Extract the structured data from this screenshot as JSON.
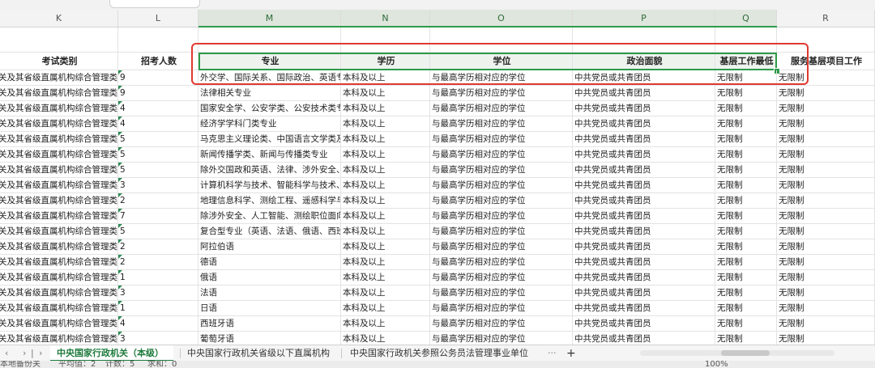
{
  "columns": [
    {
      "letter": "K"
    },
    {
      "letter": "L"
    },
    {
      "letter": "M"
    },
    {
      "letter": "N"
    },
    {
      "letter": "O"
    },
    {
      "letter": "P"
    },
    {
      "letter": "Q"
    },
    {
      "letter": "R"
    }
  ],
  "header_row": {
    "k": "考试类别",
    "l": "招考人数",
    "m": "专业",
    "n": "学历",
    "o": "学位",
    "p": "政治面貌",
    "q": "基层工作最低",
    "r": "服务基层项目工作"
  },
  "rows": [
    {
      "k": "关及其省级直属机构综合管理类",
      "l": "9",
      "m": "外交学、国际关系、国际政治、英语专业",
      "n": "本科及以上",
      "o": "与最高学历相对应的学位",
      "p": "中共党员或共青团员",
      "q": "无限制",
      "r": "无限制"
    },
    {
      "k": "关及其省级直属机构综合管理类",
      "l": "9",
      "m": "法律相关专业",
      "n": "本科及以上",
      "o": "与最高学历相对应的学位",
      "p": "中共党员或共青团员",
      "q": "无限制",
      "r": "无限制"
    },
    {
      "k": "关及其省级直属机构综合管理类",
      "l": "4",
      "m": "国家安全学、公安学类、公安技术类专业",
      "n": "本科及以上",
      "o": "与最高学历相对应的学位",
      "p": "中共党员或共青团员",
      "q": "无限制",
      "r": "无限制"
    },
    {
      "k": "关及其省级直属机构综合管理类",
      "l": "4",
      "m": "经济学学科门类专业",
      "n": "本科及以上",
      "o": "与最高学历相对应的学位",
      "p": "中共党员或共青团员",
      "q": "无限制",
      "r": "无限制"
    },
    {
      "k": "关及其省级直属机构综合管理类",
      "l": "5",
      "m": "马克思主义理论类、中国语言文学类及",
      "n": "本科及以上",
      "o": "与最高学历相对应的学位",
      "p": "中共党员或共青团员",
      "q": "无限制",
      "r": "无限制"
    },
    {
      "k": "关及其省级直属机构综合管理类",
      "l": "5",
      "m": "新闻传播学类、新闻与传播类专业",
      "n": "本科及以上",
      "o": "与最高学历相对应的学位",
      "p": "中共党员或共青团员",
      "q": "无限制",
      "r": "无限制"
    },
    {
      "k": "关及其省级直属机构综合管理类",
      "l": "5",
      "m": "除外交国政和英语、法律、涉外安全、",
      "n": "本科及以上",
      "o": "与最高学历相对应的学位",
      "p": "中共党员或共青团员",
      "q": "无限制",
      "r": "无限制"
    },
    {
      "k": "关及其省级直属机构综合管理类",
      "l": "3",
      "m": "计算机科学与技术、智能科学与技术、",
      "n": "本科及以上",
      "o": "与最高学历相对应的学位",
      "p": "中共党员或共青团员",
      "q": "无限制",
      "r": "无限制"
    },
    {
      "k": "关及其省级直属机构综合管理类",
      "l": "2",
      "m": "地理信息科学、测绘工程、遥感科学与",
      "n": "本科及以上",
      "o": "与最高学历相对应的学位",
      "p": "中共党员或共青团员",
      "q": "无限制",
      "r": "无限制"
    },
    {
      "k": "关及其省级直属机构综合管理类",
      "l": "7",
      "m": "除涉外安全、人工智能、测绘职位面向",
      "n": "本科及以上",
      "o": "与最高学历相对应的学位",
      "p": "中共党员或共青团员",
      "q": "无限制",
      "r": "无限制"
    },
    {
      "k": "关及其省级直属机构综合管理类",
      "l": "5",
      "m": "复合型专业（英语、法语、俄语、西班",
      "n": "本科及以上",
      "o": "与最高学历相对应的学位",
      "p": "中共党员或共青团员",
      "q": "无限制",
      "r": "无限制"
    },
    {
      "k": "关及其省级直属机构综合管理类",
      "l": "2",
      "m": "阿拉伯语",
      "n": "本科及以上",
      "o": "与最高学历相对应的学位",
      "p": "中共党员或共青团员",
      "q": "无限制",
      "r": "无限制"
    },
    {
      "k": "关及其省级直属机构综合管理类",
      "l": "2",
      "m": "德语",
      "n": "本科及以上",
      "o": "与最高学历相对应的学位",
      "p": "中共党员或共青团员",
      "q": "无限制",
      "r": "无限制"
    },
    {
      "k": "关及其省级直属机构综合管理类",
      "l": "1",
      "m": "俄语",
      "n": "本科及以上",
      "o": "与最高学历相对应的学位",
      "p": "中共党员或共青团员",
      "q": "无限制",
      "r": "无限制"
    },
    {
      "k": "关及其省级直属机构综合管理类",
      "l": "3",
      "m": "法语",
      "n": "本科及以上",
      "o": "与最高学历相对应的学位",
      "p": "中共党员或共青团员",
      "q": "无限制",
      "r": "无限制"
    },
    {
      "k": "关及其省级直属机构综合管理类",
      "l": "1",
      "m": "日语",
      "n": "本科及以上",
      "o": "与最高学历相对应的学位",
      "p": "中共党员或共青团员",
      "q": "无限制",
      "r": "无限制"
    },
    {
      "k": "关及其省级直属机构综合管理类",
      "l": "4",
      "m": "西班牙语",
      "n": "本科及以上",
      "o": "与最高学历相对应的学位",
      "p": "中共党员或共青团员",
      "q": "无限制",
      "r": "无限制"
    },
    {
      "k": "关及其省级直属机构综合管理类",
      "l": "3",
      "m": "葡萄牙语",
      "n": "本科及以上",
      "o": "与最高学历相对应的学位",
      "p": "中共党员或共青团员",
      "q": "无限制",
      "r": "无限制"
    }
  ],
  "sheet_tabs": [
    {
      "label": "中央国家行政机关（本级）",
      "active": true
    },
    {
      "label": "中央国家行政机关省级以下直属机构",
      "active": false
    },
    {
      "label": "中央国家行政机关参照公务员法管理事业单位",
      "active": false
    }
  ],
  "tab_nav": {
    "first": "‹",
    "prev": "›",
    "sep": "|",
    "next": "›",
    "more": "···",
    "add": "+"
  },
  "status": {
    "left": "本地备份关",
    "avg_label": "平均值：2",
    "count_label": "计数：5",
    "sum_label": "求和：0",
    "zoom": "100%"
  },
  "colors": {
    "accent": "#1e7a3c",
    "highlight_box": "#e03a2f",
    "selected_header": "#dfe6dd"
  }
}
